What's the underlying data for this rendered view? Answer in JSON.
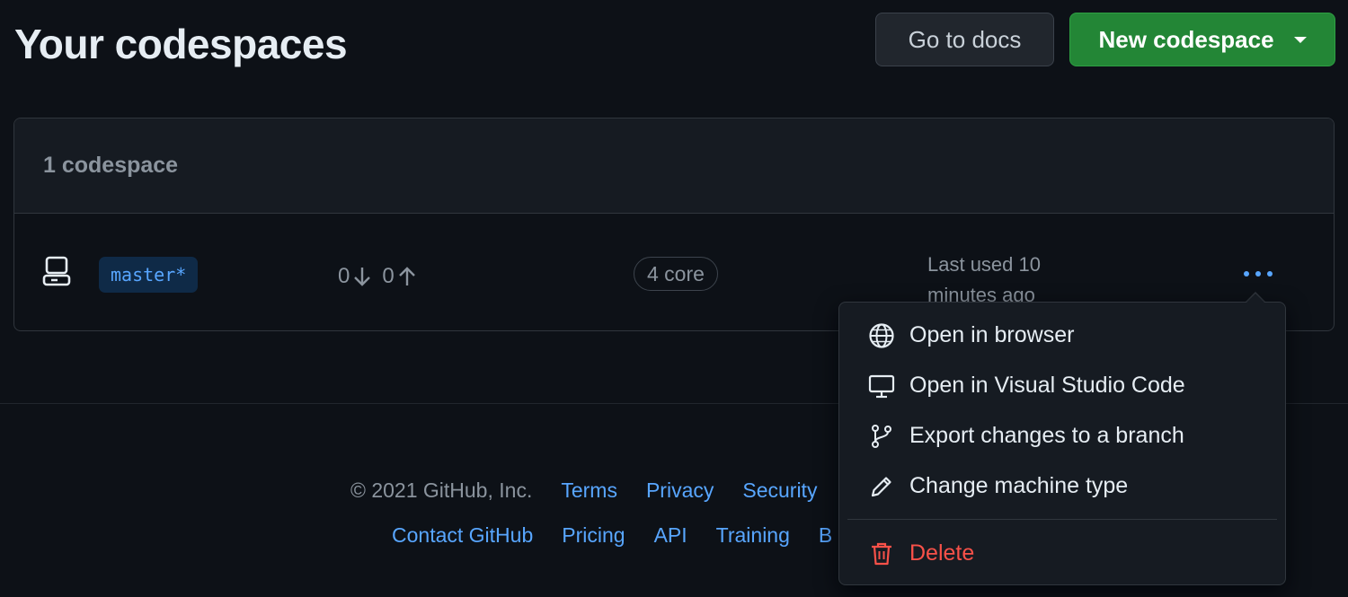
{
  "header": {
    "title": "Your codespaces",
    "docs_label": "Go to docs",
    "new_label": "New codespace"
  },
  "list": {
    "count_label": "1 codespace",
    "rows": [
      {
        "branch": "master*",
        "behind": "0",
        "ahead": "0",
        "machine": "4 core",
        "last_used": "Last used 10 minutes ago"
      }
    ]
  },
  "menu": {
    "items": [
      {
        "label": "Open in browser",
        "icon": "globe-icon"
      },
      {
        "label": "Open in Visual Studio Code",
        "icon": "monitor-icon"
      },
      {
        "label": "Export changes to a branch",
        "icon": "git-branch-icon"
      },
      {
        "label": "Change machine type",
        "icon": "pencil-icon"
      }
    ],
    "delete": {
      "label": "Delete",
      "icon": "trash-icon"
    }
  },
  "footer": {
    "copyright": "© 2021 GitHub, Inc.",
    "links_row1": [
      "Terms",
      "Privacy",
      "Security"
    ],
    "links_row2": [
      "Contact GitHub",
      "Pricing",
      "API",
      "Training",
      "B"
    ]
  },
  "colors": {
    "background": "#0d1117",
    "primary_button": "#238636",
    "link": "#58a6ff",
    "danger": "#f85149"
  }
}
